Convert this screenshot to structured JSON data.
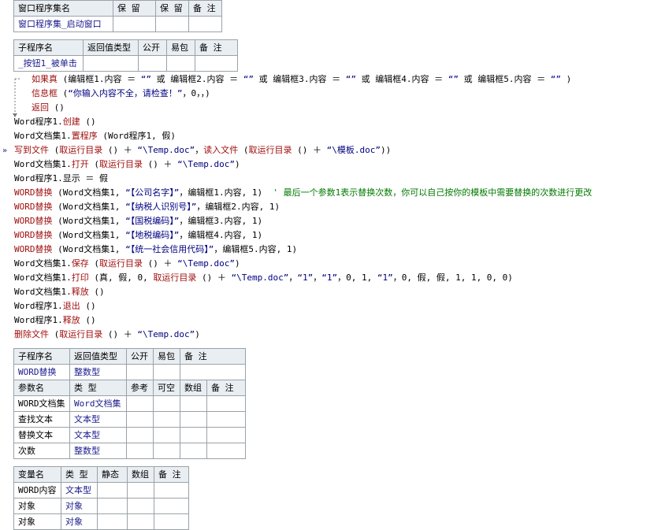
{
  "module_table": {
    "headers": [
      "窗口程序集名",
      "保 留",
      "保 留",
      "备 注"
    ],
    "row": [
      "窗口程序集_启动窗口",
      "",
      "",
      ""
    ]
  },
  "sub_table": {
    "headers": [
      "子程序名",
      "返回值类型",
      "公开",
      "易包",
      "备 注"
    ],
    "row": [
      "_按钮1_被单击",
      "",
      "",
      "",
      ""
    ]
  },
  "code_lines": [
    {
      "indent": 1,
      "parts": [
        [
          "kw",
          "如果真"
        ],
        [
          "obj",
          " (编辑框1.内容 ＝ "
        ],
        [
          "str",
          "“”"
        ],
        [
          "obj",
          " 或 编辑框2.内容 ＝ "
        ],
        [
          "str",
          "“”"
        ],
        [
          "obj",
          " 或 编辑框3.内容 ＝ "
        ],
        [
          "str",
          "“”"
        ],
        [
          "obj",
          " 或 编辑框4.内容 ＝ "
        ],
        [
          "str",
          "“”"
        ],
        [
          "obj",
          " 或 编辑框5.内容 ＝ "
        ],
        [
          "str",
          "“”"
        ],
        [
          "obj",
          " )"
        ]
      ]
    },
    {
      "indent": 1,
      "parts": [
        [
          "kw",
          "信息框"
        ],
        [
          "obj",
          " ("
        ],
        [
          "str",
          "“你输入内容不全，请检查！”"
        ],
        [
          "obj",
          "，0，，)"
        ]
      ]
    },
    {
      "indent": 1,
      "parts": [
        [
          "kw",
          "返回"
        ],
        [
          "obj",
          " ()"
        ]
      ]
    },
    {
      "indent": 0,
      "parts": [
        [
          "obj",
          "Word程序1."
        ],
        [
          "kw",
          "创建"
        ],
        [
          "obj",
          " ()"
        ]
      ]
    },
    {
      "indent": 0,
      "parts": [
        [
          "obj",
          "Word文档集1."
        ],
        [
          "kw",
          "置程序"
        ],
        [
          "obj",
          " (Word程序1, 假)"
        ]
      ]
    },
    {
      "indent": 0,
      "parts": [
        [
          "kw",
          "写到文件"
        ],
        [
          "obj",
          " ("
        ],
        [
          "kw",
          "取运行目录"
        ],
        [
          "obj",
          " () ＋ "
        ],
        [
          "str",
          "“\\Temp.doc”"
        ],
        [
          "obj",
          "，"
        ],
        [
          "kw",
          "读入文件"
        ],
        [
          "obj",
          " ("
        ],
        [
          "kw",
          "取运行目录"
        ],
        [
          "obj",
          " () ＋ "
        ],
        [
          "str",
          "“\\模板.doc”"
        ],
        [
          "obj",
          "))"
        ]
      ]
    },
    {
      "indent": 0,
      "parts": [
        [
          "obj",
          "Word文档集1."
        ],
        [
          "kw",
          "打开"
        ],
        [
          "obj",
          " ("
        ],
        [
          "kw",
          "取运行目录"
        ],
        [
          "obj",
          " () ＋ "
        ],
        [
          "str",
          "“\\Temp.doc”"
        ],
        [
          "obj",
          ")"
        ]
      ]
    },
    {
      "indent": 0,
      "parts": [
        [
          "obj",
          "Word程序1.显示 ＝ 假"
        ]
      ]
    },
    {
      "indent": 0,
      "parts": [
        [
          "kw",
          "WORD替换"
        ],
        [
          "obj",
          " (Word文档集1, "
        ],
        [
          "str",
          "“【公司名字】”"
        ],
        [
          "obj",
          "，编辑框1.内容, 1)"
        ],
        [
          "cmt",
          "  ' 最后一个参数1表示替换次数，你可以自己按你的模板中需要替换的次数进行更改"
        ]
      ]
    },
    {
      "indent": 0,
      "parts": [
        [
          "kw",
          "WORD替换"
        ],
        [
          "obj",
          " (Word文档集1, "
        ],
        [
          "str",
          "“【纳税人识别号】”"
        ],
        [
          "obj",
          "，编辑框2.内容, 1)"
        ]
      ]
    },
    {
      "indent": 0,
      "parts": [
        [
          "kw",
          "WORD替换"
        ],
        [
          "obj",
          " (Word文档集1, "
        ],
        [
          "str",
          "“【国税编码】”"
        ],
        [
          "obj",
          "，编辑框3.内容, 1)"
        ]
      ]
    },
    {
      "indent": 0,
      "parts": [
        [
          "kw",
          "WORD替换"
        ],
        [
          "obj",
          " (Word文档集1, "
        ],
        [
          "str",
          "“【地税编码】”"
        ],
        [
          "obj",
          "，编辑框4.内容, 1)"
        ]
      ]
    },
    {
      "indent": 0,
      "parts": [
        [
          "kw",
          "WORD替换"
        ],
        [
          "obj",
          " (Word文档集1, "
        ],
        [
          "str",
          "“【统一社会信用代码】”"
        ],
        [
          "obj",
          "，编辑框5.内容, 1)"
        ]
      ]
    },
    {
      "indent": 0,
      "parts": [
        [
          "obj",
          "Word文档集1."
        ],
        [
          "kw",
          "保存"
        ],
        [
          "obj",
          " ("
        ],
        [
          "kw",
          "取运行目录"
        ],
        [
          "obj",
          " () ＋ "
        ],
        [
          "str",
          "“\\Temp.doc”"
        ],
        [
          "obj",
          ")"
        ]
      ]
    },
    {
      "indent": 0,
      "parts": [
        [
          "obj",
          "Word文档集1."
        ],
        [
          "kw",
          "打印"
        ],
        [
          "obj",
          " (真, 假, 0, "
        ],
        [
          "kw",
          "取运行目录"
        ],
        [
          "obj",
          " () ＋ "
        ],
        [
          "str",
          "“\\Temp.doc”"
        ],
        [
          "obj",
          "，"
        ],
        [
          "str",
          "“1”"
        ],
        [
          "obj",
          "，"
        ],
        [
          "str",
          "“1”"
        ],
        [
          "obj",
          "，0, 1, "
        ],
        [
          "str",
          "“1”"
        ],
        [
          "obj",
          "，0, 假, 假, 1, 1, 0, 0)"
        ]
      ]
    },
    {
      "indent": 0,
      "parts": [
        [
          "obj",
          "Word文档集1."
        ],
        [
          "kw",
          "释放"
        ],
        [
          "obj",
          " ()"
        ]
      ]
    },
    {
      "indent": 0,
      "parts": [
        [
          "obj",
          "Word程序1."
        ],
        [
          "kw",
          "退出"
        ],
        [
          "obj",
          " ()"
        ]
      ]
    },
    {
      "indent": 0,
      "parts": [
        [
          "obj",
          "Word程序1."
        ],
        [
          "kw",
          "释放"
        ],
        [
          "obj",
          " ()"
        ]
      ]
    },
    {
      "indent": 0,
      "parts": [
        [
          "kw",
          "删除文件"
        ],
        [
          "obj",
          " ("
        ],
        [
          "kw",
          "取运行目录"
        ],
        [
          "obj",
          " () ＋ "
        ],
        [
          "str",
          "“\\Temp.doc”"
        ],
        [
          "obj",
          ")"
        ]
      ]
    }
  ],
  "word_replace_table": {
    "headers": [
      "子程序名",
      "返回值类型",
      "公开",
      "易包",
      "备 注"
    ],
    "row": [
      "WORD替换",
      "整数型",
      "",
      "",
      ""
    ],
    "param_headers": [
      "参数名",
      "类 型",
      "参考",
      "可空",
      "数组",
      "备 注"
    ],
    "params": [
      [
        "WORD文档集",
        "Word文档集",
        "",
        "",
        "",
        ""
      ],
      [
        "查找文本",
        "文本型",
        "",
        "",
        "",
        ""
      ],
      [
        "替换文本",
        "文本型",
        "",
        "",
        "",
        ""
      ],
      [
        "次数",
        "整数型",
        "",
        "",
        "",
        ""
      ]
    ]
  },
  "var_table": {
    "headers": [
      "变量名",
      "类 型",
      "静态",
      "数组",
      "备 注"
    ],
    "rows": [
      [
        "WORD内容",
        "文本型",
        "",
        "",
        ""
      ],
      [
        "对象",
        "对象",
        "",
        "",
        ""
      ],
      [
        "对象",
        "对象",
        "",
        "",
        ""
      ]
    ]
  }
}
